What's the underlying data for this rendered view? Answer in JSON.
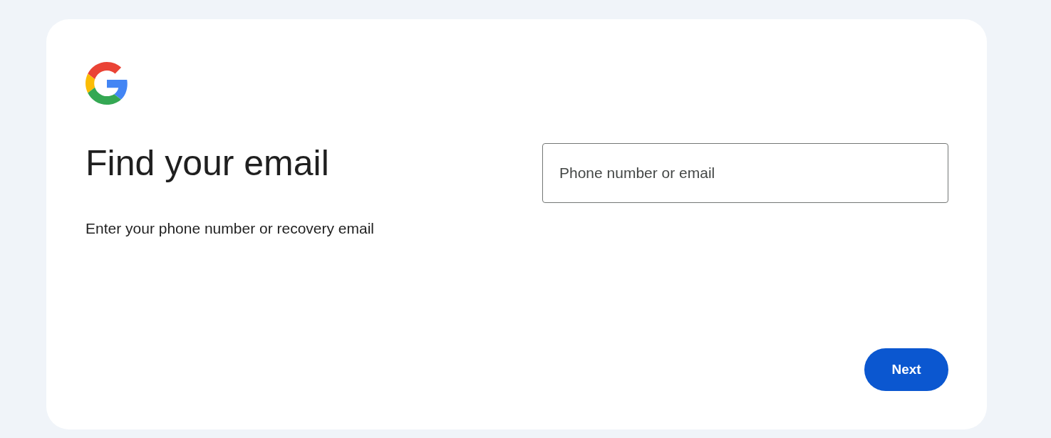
{
  "heading": "Find your email",
  "subtitle": "Enter your phone number or recovery email",
  "field": {
    "placeholder": "Phone number or email"
  },
  "buttons": [
    {
      "label": "Next",
      "kind": "primary"
    }
  ]
}
